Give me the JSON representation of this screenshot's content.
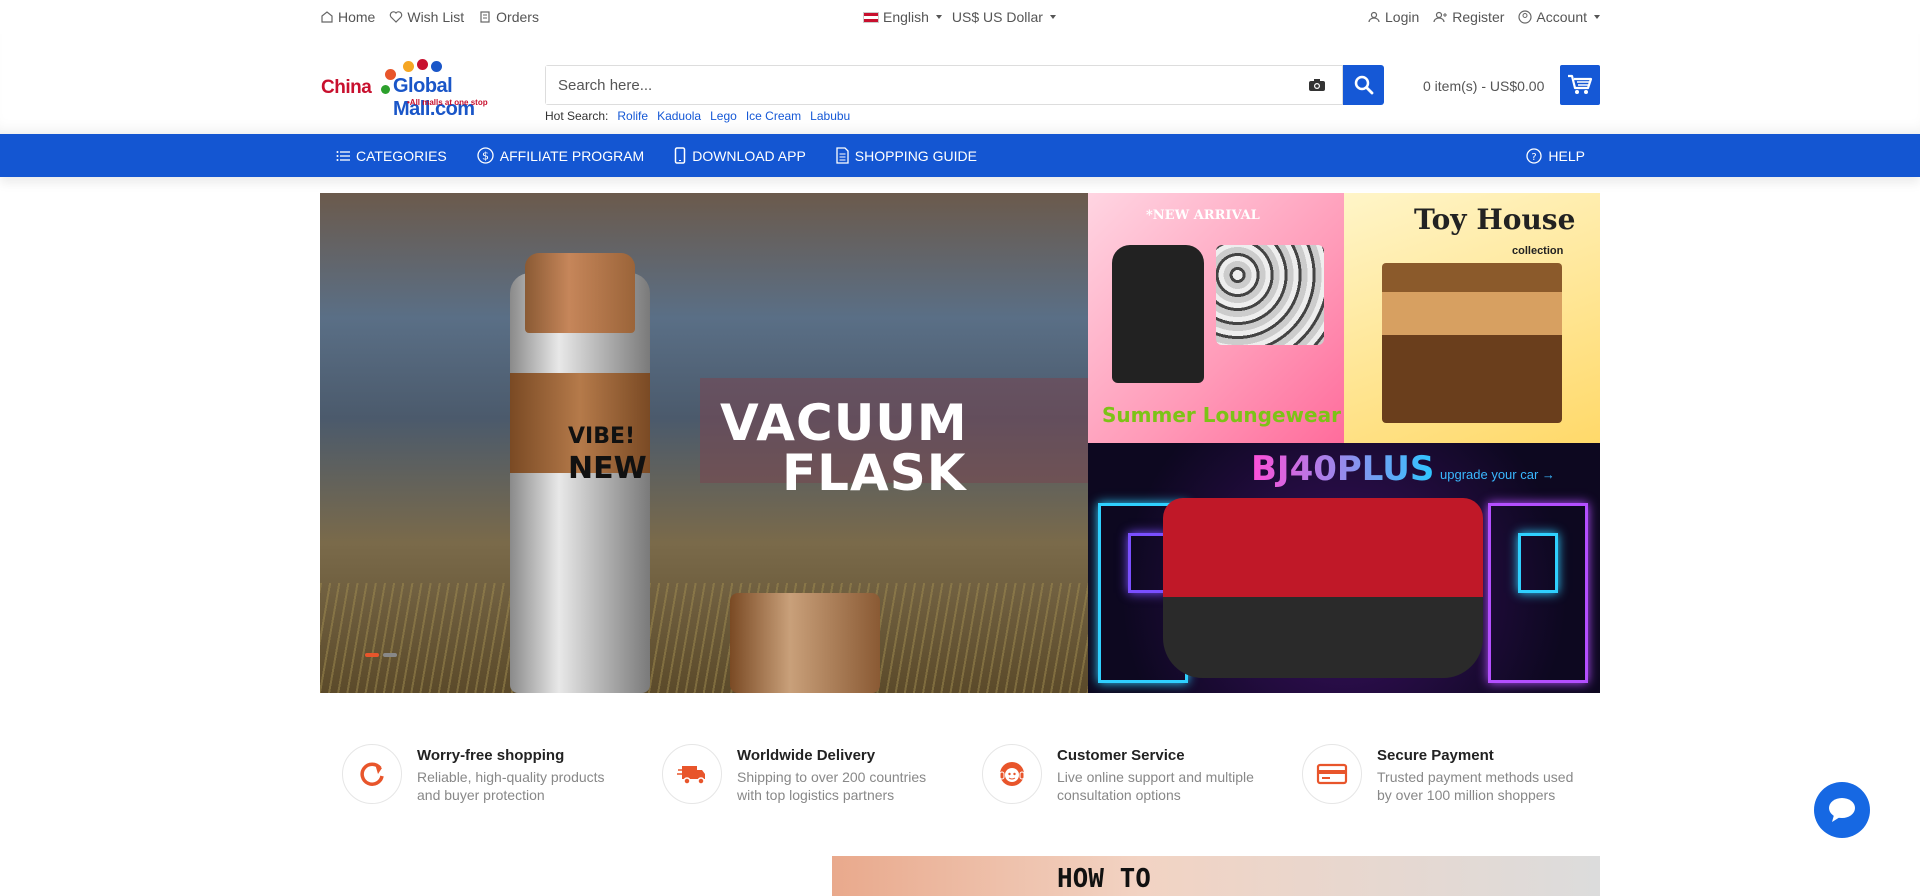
{
  "topbar": {
    "home": "Home",
    "wishlist": "Wish List",
    "orders": "Orders",
    "language": "English",
    "currency": "US$ US Dollar",
    "login": "Login",
    "register": "Register",
    "account": "Account"
  },
  "header": {
    "logo_china": "China",
    "logo_globalmall": "Global Mall.com",
    "logo_tagline": "•All malls at one stop",
    "search_placeholder": "Search here...",
    "hot_label": "Hot Search:",
    "hot_terms": [
      "Rolife",
      "Kaduola",
      "Lego",
      "Ice Cream",
      "Labubu"
    ],
    "cart_text": "0 item(s) - US$0.00"
  },
  "nav": {
    "items": [
      "CATEGORIES",
      "AFFILIATE PROGRAM",
      "DOWNLOAD APP",
      "SHOPPING GUIDE"
    ],
    "help": "HELP"
  },
  "banners": {
    "main": {
      "label_line1": "VIBE!",
      "label_line2": "NEW",
      "title_line1": "VACUUM",
      "title_line2": "FLASK",
      "slides": 2,
      "active_slide": 1
    },
    "side1": {
      "tag": "*NEW ARRIVAL",
      "title": "Summer Loungewear"
    },
    "side2": {
      "title": "Toy House",
      "subtitle": "collection"
    },
    "side3": {
      "title": "BJ40PLUS",
      "cta": "upgrade your car →"
    }
  },
  "features": [
    {
      "title": "Worry-free shopping",
      "desc": "Reliable, high-quality products and buyer protection",
      "icon": "refresh-icon"
    },
    {
      "title": "Worldwide Delivery",
      "desc": "Shipping to over 200 countries with top logistics partners",
      "icon": "truck-icon"
    },
    {
      "title": "Customer Service",
      "desc": "Live online support and multiple consultation options",
      "icon": "support-agent-icon"
    },
    {
      "title": "Secure Payment",
      "desc": "Trusted payment methods used by over 100 million shoppers",
      "icon": "credit-card-icon"
    }
  ],
  "bottom": {
    "howto": "HOW TO"
  },
  "colors": {
    "primary": "#1456d2",
    "accent": "#e8552b"
  }
}
